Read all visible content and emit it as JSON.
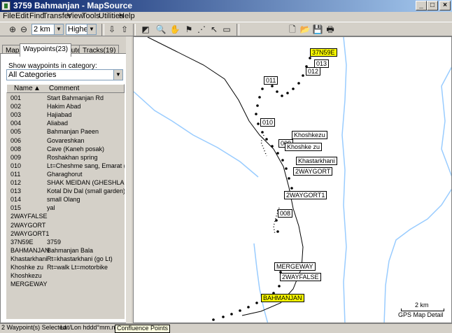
{
  "window": {
    "title": "3759 Bahmanjan - MapSource"
  },
  "menu": [
    "File",
    "Edit",
    "Find",
    "Transfer",
    "View",
    "Tools",
    "Utilities",
    "Help"
  ],
  "toolbar": {
    "zoom_value": "2 km",
    "detail_value": "Highest"
  },
  "tabs": [
    "Maps",
    "Waypoints(23)",
    "Routes",
    "Tracks(19)"
  ],
  "panel": {
    "show_label": "Show waypoints in category:",
    "category": "All Categories",
    "col_name": "Name",
    "col_comment": "Comment",
    "rows": [
      {
        "name": "001",
        "comment": "Start Bahmanjan Rd"
      },
      {
        "name": "002",
        "comment": "Hakim Abad"
      },
      {
        "name": "003",
        "comment": "Hajiabad"
      },
      {
        "name": "004",
        "comment": "Aliabad"
      },
      {
        "name": "005",
        "comment": "Bahmanjan Paeen"
      },
      {
        "name": "006",
        "comment": "Govareshkan"
      },
      {
        "name": "008",
        "comment": "Cave (Kaneh posak)"
      },
      {
        "name": "009",
        "comment": "Roshakhan spring"
      },
      {
        "name": "010",
        "comment": "Lt=Cheshme sang, Emarat (go Rt)"
      },
      {
        "name": "011",
        "comment": "Gharaghorut"
      },
      {
        "name": "012",
        "comment": "SHAK MEIDAN (GHESHLAGH)"
      },
      {
        "name": "013",
        "comment": "Kotal Div Dal (small garden)"
      },
      {
        "name": "014",
        "comment": "small Olang"
      },
      {
        "name": "015",
        "comment": "yal"
      },
      {
        "name": "2WAYFALSE",
        "comment": ""
      },
      {
        "name": "2WAYGORT",
        "comment": ""
      },
      {
        "name": "2WAYGORT1",
        "comment": ""
      },
      {
        "name": "37N59E",
        "comment": "3759"
      },
      {
        "name": "BAHMANJAN",
        "comment": "Bahmanjan Bala"
      },
      {
        "name": "Khastarkhani",
        "comment": "Rt=khastarkhani (go Lt)"
      },
      {
        "name": "Khoshke zu",
        "comment": "Rt=walk Lt=motorbike"
      },
      {
        "name": "Khoshkezu",
        "comment": ""
      },
      {
        "name": "MERGEWAY",
        "comment": ""
      }
    ]
  },
  "map": {
    "labels": {
      "w37n59e": "37N59E",
      "w013": "013",
      "w012": "012",
      "w011": "011",
      "w010": "010",
      "khoshkezu": "Khoshkezu",
      "w009": "009",
      "khoshkezu2": "Khoshke zu",
      "khastarkhani": "Khastarkhani",
      "twowaygort": "2WAYGORT",
      "twowaygort1": "2WAYGORT1",
      "w008": "008",
      "mergeway": "MERGEWAY",
      "twowayfalse": "2WAYFALSE",
      "bahmanjan": "BAHMANJAN"
    },
    "scale_label": "2 km",
    "scale_detail": "GPS Map Detail"
  },
  "status": {
    "selected": "2 Waypoint(s) Selected",
    "coords": "Lat/Lon hddd°mm.mmm'(W",
    "tooltip": "Confluence Points"
  }
}
